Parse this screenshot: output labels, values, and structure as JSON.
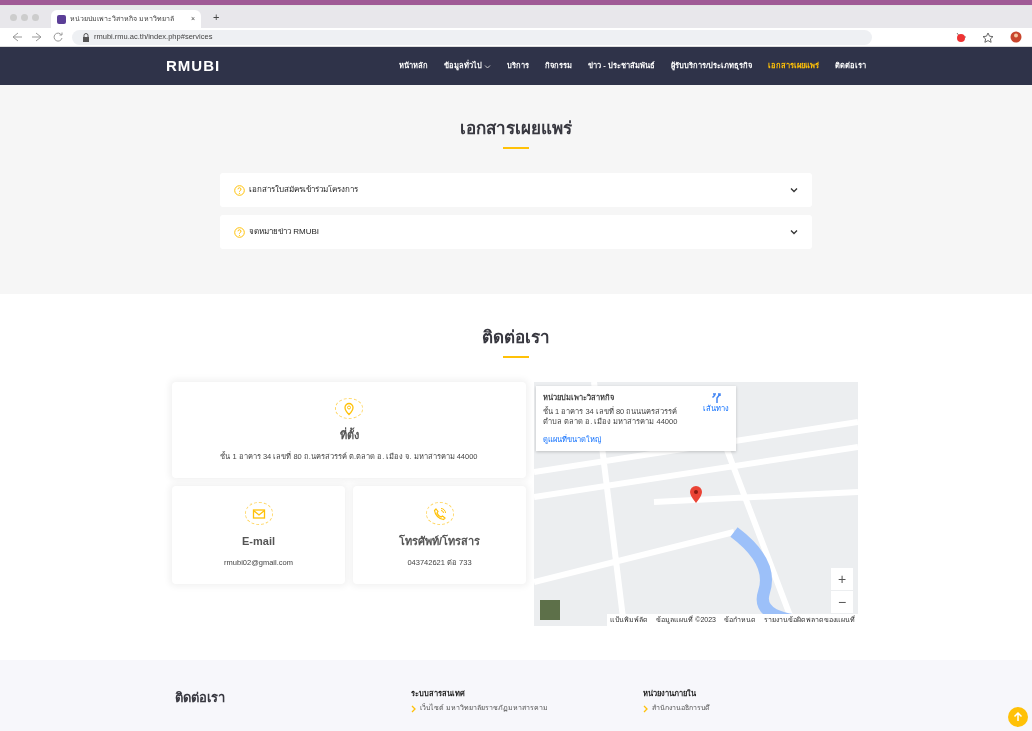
{
  "browser": {
    "tab_title": "หน่วยบ่มเพาะวิสาหกิจ มหาวิทยาลั",
    "tab_close": "×",
    "new_tab": "+",
    "url": "rmubi.rmu.ac.th/index.php#services"
  },
  "navbar": {
    "brand": "RMUBI",
    "items": [
      {
        "label": "หน้าหลัก",
        "selected": false,
        "dropdown": false
      },
      {
        "label": "ข้อมูลทั่วไป",
        "selected": false,
        "dropdown": true
      },
      {
        "label": "บริการ",
        "selected": false,
        "dropdown": false
      },
      {
        "label": "กิจกรรม",
        "selected": false,
        "dropdown": false
      },
      {
        "label": "ข่าว - ประชาสัมพันธ์",
        "selected": false,
        "dropdown": false
      },
      {
        "label": "ผู้รับบริการ/ประเภทธุรกิจ",
        "selected": false,
        "dropdown": false
      },
      {
        "label": "เอกสารเผยแพร่",
        "selected": true,
        "dropdown": false
      },
      {
        "label": "ติดต่อเรา",
        "selected": false,
        "dropdown": false
      }
    ]
  },
  "documents": {
    "title": "เอกสารเผยแพร่",
    "items": [
      {
        "label": "เอกสารใบสมัครเข้าร่วมโครงการ",
        "expanded": false
      },
      {
        "label": "จดหมายข่าว RMUBI",
        "expanded": false
      }
    ]
  },
  "contact": {
    "title": "ติดต่อเรา",
    "cards": [
      {
        "kind": "location",
        "title": "ที่ตั้ง",
        "text": "ชั้น 1 อาคาร 34 เลขที่ 80 ถ.นครสวรรค์ ต.ตลาด อ. เมือง จ. มหาสารคาม 44000"
      },
      {
        "kind": "email",
        "title": "E-mail",
        "text": "rmubi02@gmail.com"
      },
      {
        "kind": "phone",
        "title": "โทรศัพท์/โทรสาร",
        "text": "043742621 ต่อ 733"
      }
    ],
    "map": {
      "info_title": "หน่วยบ่มเพาะวิสาหกิจ",
      "info_address": "ชั้น 1 อาคาร 34 เลขที่ 80 ถนนนครสวรรค์ ตำบล ตลาด อ. เมือง มหาสารคาม 44000",
      "directions": "เส้นทาง",
      "larger_map": "ดูแผนที่ขนาดใหญ่",
      "zoom_in": "+",
      "zoom_out": "−",
      "attribution": [
        "แป้นพิมพ์ลัด",
        "ข้อมูลแผนที่ ©2023",
        "ข้อกำหนด",
        "รายงานข้อผิดพลาดของแผนที่"
      ]
    }
  },
  "footer": {
    "columns": [
      {
        "title": "ติดต่อเรา"
      },
      {
        "title": "ระบบสารสนเทศ",
        "links": [
          "เว็บไซต์ มหาวิทยาลัยราชภัฏมหาสารคาม"
        ]
      },
      {
        "title": "หน่วยงานภายใน",
        "links": [
          "สำนักงานอธิการบดี"
        ]
      }
    ]
  }
}
